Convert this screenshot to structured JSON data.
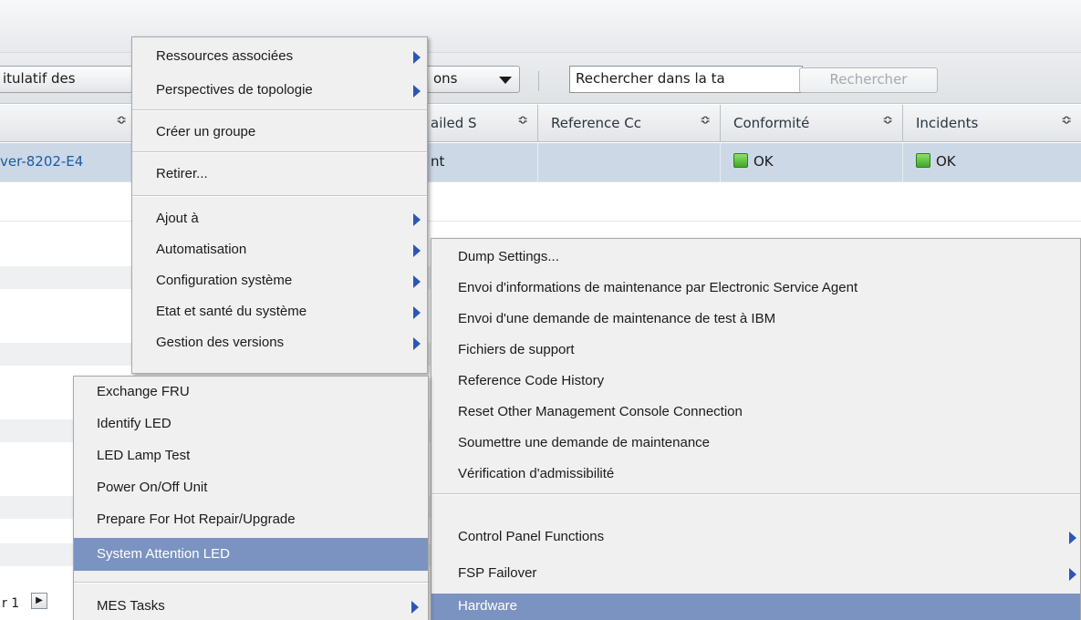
{
  "toolbar": {
    "summary_label": "itulatif des",
    "actions_label": "ons",
    "search_value": "Rechercher dans la ta",
    "search_button": "Rechercher"
  },
  "table": {
    "columns": [
      {
        "label": "",
        "sort": "≎"
      },
      {
        "label": "ailed S",
        "sort": "≎"
      },
      {
        "label": "Reference Cc",
        "sort": "≎"
      },
      {
        "label": "Conformité",
        "sort": "≎"
      },
      {
        "label": "Incidents",
        "sort": "≎"
      }
    ],
    "rows": [
      {
        "name": "ver-8202-E4",
        "failed": "nt",
        "reference": "",
        "conformite": "OK",
        "incidents": "OK"
      }
    ]
  },
  "pager": {
    "text": "r 1",
    "next_glyph": "▶"
  },
  "menus": {
    "main": [
      "Ressources associées",
      "Perspectives de topologie",
      "Créer un groupe",
      "Retirer...",
      "Ajout à",
      "Automatisation",
      "Configuration système",
      "Etat et santé du système",
      "Gestion des versions"
    ],
    "service": [
      "Dump Settings...",
      "Envoi d'informations de maintenance par Electronic Service Agent",
      "Envoi d'une demande de maintenance de test à IBM",
      "Fichiers de support",
      "Reference Code History",
      "Reset Other Management Console Connection",
      "Soumettre une demande de maintenance",
      "Vérification d'admissibilité",
      "Control Panel Functions",
      "FSP Failover",
      "Hardware"
    ],
    "hardware": [
      "Exchange FRU",
      "Identify LED",
      "LED Lamp Test",
      "Power On/Off Unit",
      "Prepare For Hot Repair/Upgrade",
      "System Attention LED",
      "MES Tasks"
    ]
  },
  "colors": {
    "highlight": "#7b93c1",
    "submenu_arrow": "#2b56b8",
    "status_ok": "#3ea72a",
    "selected_row": "#cdd8e6",
    "link": "#1a5aa8"
  }
}
